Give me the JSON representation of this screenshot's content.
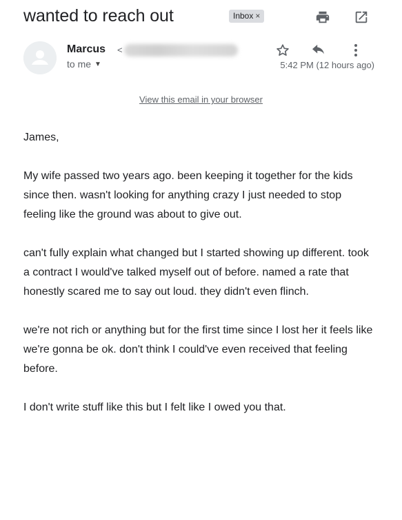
{
  "email": {
    "subject": "wanted to reach out",
    "label": "Inbox",
    "label_close": "×",
    "sender_name": "Marcus",
    "sender_lt": "<",
    "recipient_line": "to me",
    "recipient_caret": "▼",
    "timestamp": "5:42 PM (12 hours ago)",
    "view_in_browser": "View this email in your browser",
    "body": [
      "James,",
      "My wife passed two years ago. been keeping it together for the kids since then. wasn't looking for anything crazy I just needed to stop feeling like the ground was about to give out.",
      "can't fully explain what changed but I started showing up different. took a contract I would've talked myself out of before. named a rate that honestly scared me to say out loud. they didn't even flinch.",
      "we're not rich or anything but for the first time since I lost her it feels like we're gonna be ok. don't think I could've even received that feeling before.",
      "I don't write stuff like this but I felt like I owed you that."
    ]
  },
  "icons": {
    "print": "print-icon",
    "new_window": "open-in-new-window-icon",
    "star": "star-icon",
    "reply": "reply-icon",
    "more": "more-vertical-icon",
    "avatar": "default-avatar-icon"
  },
  "colors": {
    "text": "#202124",
    "secondary_text": "#5f6368",
    "chip_background": "#dadce0",
    "icon": "#5f6368"
  }
}
